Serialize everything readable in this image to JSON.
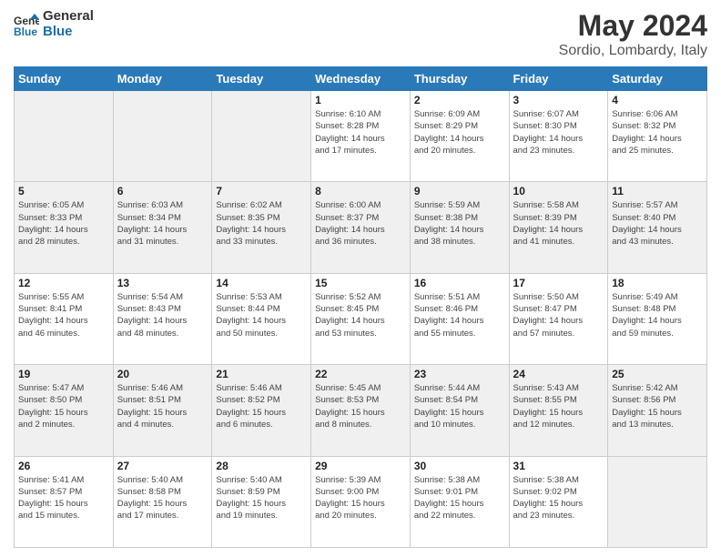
{
  "header": {
    "logo_line1": "General",
    "logo_line2": "Blue",
    "title": "May 2024",
    "subtitle": "Sordio, Lombardy, Italy"
  },
  "days_of_week": [
    "Sunday",
    "Monday",
    "Tuesday",
    "Wednesday",
    "Thursday",
    "Friday",
    "Saturday"
  ],
  "weeks": [
    [
      {
        "day": "",
        "info": ""
      },
      {
        "day": "",
        "info": ""
      },
      {
        "day": "",
        "info": ""
      },
      {
        "day": "1",
        "info": "Sunrise: 6:10 AM\nSunset: 8:28 PM\nDaylight: 14 hours\nand 17 minutes."
      },
      {
        "day": "2",
        "info": "Sunrise: 6:09 AM\nSunset: 8:29 PM\nDaylight: 14 hours\nand 20 minutes."
      },
      {
        "day": "3",
        "info": "Sunrise: 6:07 AM\nSunset: 8:30 PM\nDaylight: 14 hours\nand 23 minutes."
      },
      {
        "day": "4",
        "info": "Sunrise: 6:06 AM\nSunset: 8:32 PM\nDaylight: 14 hours\nand 25 minutes."
      }
    ],
    [
      {
        "day": "5",
        "info": "Sunrise: 6:05 AM\nSunset: 8:33 PM\nDaylight: 14 hours\nand 28 minutes."
      },
      {
        "day": "6",
        "info": "Sunrise: 6:03 AM\nSunset: 8:34 PM\nDaylight: 14 hours\nand 31 minutes."
      },
      {
        "day": "7",
        "info": "Sunrise: 6:02 AM\nSunset: 8:35 PM\nDaylight: 14 hours\nand 33 minutes."
      },
      {
        "day": "8",
        "info": "Sunrise: 6:00 AM\nSunset: 8:37 PM\nDaylight: 14 hours\nand 36 minutes."
      },
      {
        "day": "9",
        "info": "Sunrise: 5:59 AM\nSunset: 8:38 PM\nDaylight: 14 hours\nand 38 minutes."
      },
      {
        "day": "10",
        "info": "Sunrise: 5:58 AM\nSunset: 8:39 PM\nDaylight: 14 hours\nand 41 minutes."
      },
      {
        "day": "11",
        "info": "Sunrise: 5:57 AM\nSunset: 8:40 PM\nDaylight: 14 hours\nand 43 minutes."
      }
    ],
    [
      {
        "day": "12",
        "info": "Sunrise: 5:55 AM\nSunset: 8:41 PM\nDaylight: 14 hours\nand 46 minutes."
      },
      {
        "day": "13",
        "info": "Sunrise: 5:54 AM\nSunset: 8:43 PM\nDaylight: 14 hours\nand 48 minutes."
      },
      {
        "day": "14",
        "info": "Sunrise: 5:53 AM\nSunset: 8:44 PM\nDaylight: 14 hours\nand 50 minutes."
      },
      {
        "day": "15",
        "info": "Sunrise: 5:52 AM\nSunset: 8:45 PM\nDaylight: 14 hours\nand 53 minutes."
      },
      {
        "day": "16",
        "info": "Sunrise: 5:51 AM\nSunset: 8:46 PM\nDaylight: 14 hours\nand 55 minutes."
      },
      {
        "day": "17",
        "info": "Sunrise: 5:50 AM\nSunset: 8:47 PM\nDaylight: 14 hours\nand 57 minutes."
      },
      {
        "day": "18",
        "info": "Sunrise: 5:49 AM\nSunset: 8:48 PM\nDaylight: 14 hours\nand 59 minutes."
      }
    ],
    [
      {
        "day": "19",
        "info": "Sunrise: 5:47 AM\nSunset: 8:50 PM\nDaylight: 15 hours\nand 2 minutes."
      },
      {
        "day": "20",
        "info": "Sunrise: 5:46 AM\nSunset: 8:51 PM\nDaylight: 15 hours\nand 4 minutes."
      },
      {
        "day": "21",
        "info": "Sunrise: 5:46 AM\nSunset: 8:52 PM\nDaylight: 15 hours\nand 6 minutes."
      },
      {
        "day": "22",
        "info": "Sunrise: 5:45 AM\nSunset: 8:53 PM\nDaylight: 15 hours\nand 8 minutes."
      },
      {
        "day": "23",
        "info": "Sunrise: 5:44 AM\nSunset: 8:54 PM\nDaylight: 15 hours\nand 10 minutes."
      },
      {
        "day": "24",
        "info": "Sunrise: 5:43 AM\nSunset: 8:55 PM\nDaylight: 15 hours\nand 12 minutes."
      },
      {
        "day": "25",
        "info": "Sunrise: 5:42 AM\nSunset: 8:56 PM\nDaylight: 15 hours\nand 13 minutes."
      }
    ],
    [
      {
        "day": "26",
        "info": "Sunrise: 5:41 AM\nSunset: 8:57 PM\nDaylight: 15 hours\nand 15 minutes."
      },
      {
        "day": "27",
        "info": "Sunrise: 5:40 AM\nSunset: 8:58 PM\nDaylight: 15 hours\nand 17 minutes."
      },
      {
        "day": "28",
        "info": "Sunrise: 5:40 AM\nSunset: 8:59 PM\nDaylight: 15 hours\nand 19 minutes."
      },
      {
        "day": "29",
        "info": "Sunrise: 5:39 AM\nSunset: 9:00 PM\nDaylight: 15 hours\nand 20 minutes."
      },
      {
        "day": "30",
        "info": "Sunrise: 5:38 AM\nSunset: 9:01 PM\nDaylight: 15 hours\nand 22 minutes."
      },
      {
        "day": "31",
        "info": "Sunrise: 5:38 AM\nSunset: 9:02 PM\nDaylight: 15 hours\nand 23 minutes."
      },
      {
        "day": "",
        "info": ""
      }
    ]
  ]
}
